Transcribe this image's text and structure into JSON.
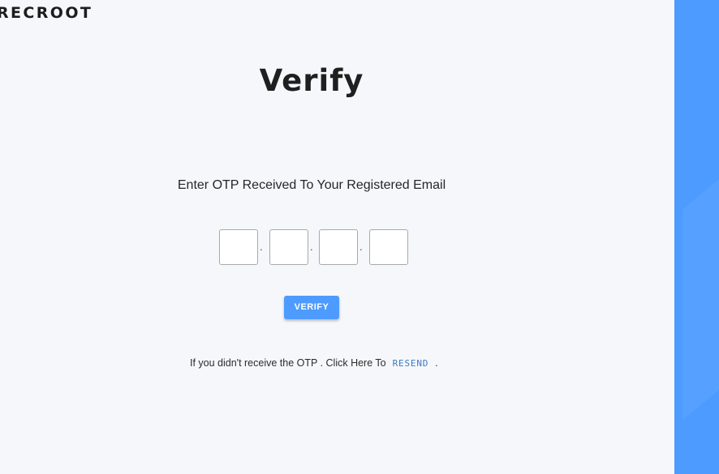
{
  "brand": {
    "logo_text": "RECROOT"
  },
  "page": {
    "title": "Verify",
    "instruction": "Enter OTP Received To Your Registered Email"
  },
  "otp": {
    "digits": [
      "",
      "",
      "",
      ""
    ],
    "separator": "."
  },
  "actions": {
    "verify_label": "VERIFY"
  },
  "resend": {
    "prefix": "If you didn't receive the OTP . Click Here To",
    "link_label": "RESEND",
    "suffix": "."
  },
  "colors": {
    "accent": "#4d9bff",
    "background": "#f6f7fb",
    "link": "#3a78c8"
  }
}
